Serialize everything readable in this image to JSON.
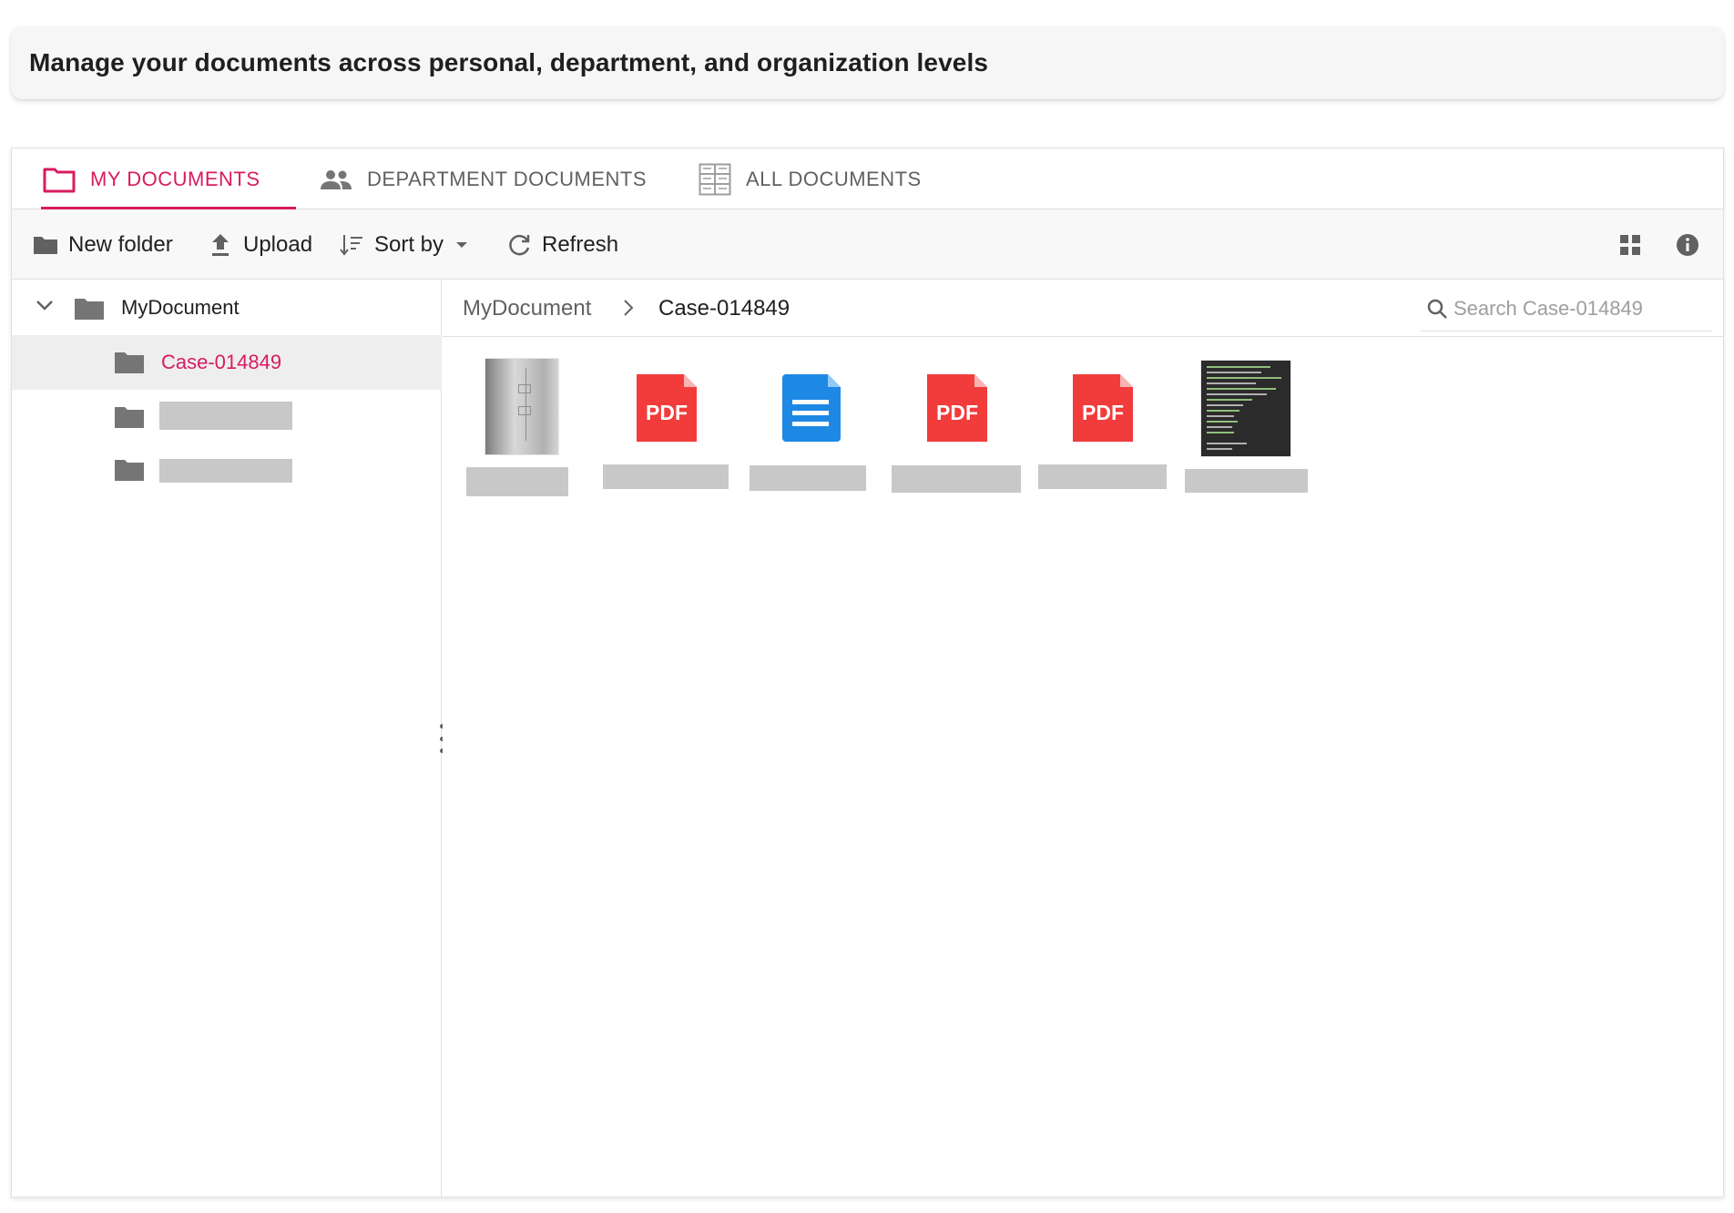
{
  "header": {
    "title": "Manage your documents across personal, department, and organization levels"
  },
  "tabs": [
    {
      "label": "MY DOCUMENTS",
      "icon": "folder-icon"
    },
    {
      "label": "DEPARTMENT DOCUMENTS",
      "icon": "people-icon"
    },
    {
      "label": "ALL DOCUMENTS",
      "icon": "grid-documents-icon"
    }
  ],
  "toolbar": {
    "new_folder": "New folder",
    "upload": "Upload",
    "sort_by": "Sort by",
    "refresh": "Refresh"
  },
  "nav": {
    "root": "MyDocument",
    "selected": "Case-014849"
  },
  "breadcrumb": {
    "parent": "MyDocument",
    "current": "Case-014849"
  },
  "search": {
    "placeholder": "Search Case-014849"
  },
  "files": [
    {
      "type": "image"
    },
    {
      "type": "pdf",
      "badge": "PDF"
    },
    {
      "type": "document"
    },
    {
      "type": "pdf",
      "badge": "PDF"
    },
    {
      "type": "pdf",
      "badge": "PDF"
    },
    {
      "type": "image"
    }
  ],
  "colors": {
    "accent": "#d81b60",
    "pdf": "#f23b3b",
    "doc": "#1e88e5",
    "icon": "#757575"
  }
}
